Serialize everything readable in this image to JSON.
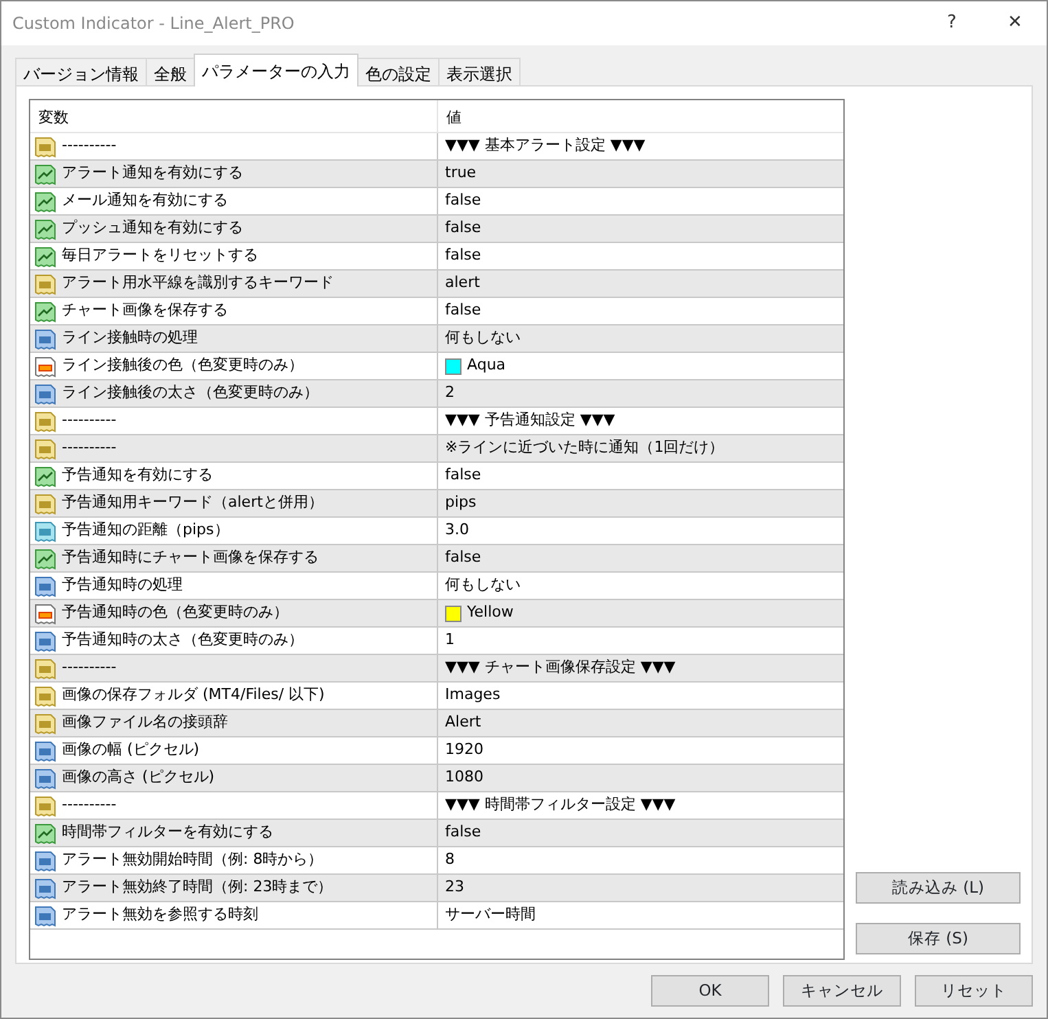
{
  "window": {
    "title": "Custom Indicator - Line_Alert_PRO",
    "help": "?",
    "close": "✕"
  },
  "tabs": [
    {
      "label": "バージョン情報",
      "selected": false
    },
    {
      "label": "全般",
      "selected": false
    },
    {
      "label": "パラメーターの入力",
      "selected": true
    },
    {
      "label": "色の設定",
      "selected": false
    },
    {
      "label": "表示選択",
      "selected": false
    }
  ],
  "table": {
    "columns": [
      "変数",
      "値"
    ],
    "rows": [
      {
        "kind": "string",
        "name": "----------",
        "value": "▼▼▼ 基本アラート設定 ▼▼▼"
      },
      {
        "kind": "bool",
        "name": "アラート通知を有効にする",
        "value": "true"
      },
      {
        "kind": "bool",
        "name": "メール通知を有効にする",
        "value": "false"
      },
      {
        "kind": "bool",
        "name": "プッシュ通知を有効にする",
        "value": "false"
      },
      {
        "kind": "bool",
        "name": "毎日アラートをリセットする",
        "value": "false"
      },
      {
        "kind": "string",
        "name": "アラート用水平線を識別するキーワード",
        "value": "alert"
      },
      {
        "kind": "bool",
        "name": "チャート画像を保存する",
        "value": "false"
      },
      {
        "kind": "int",
        "name": "ライン接触時の処理",
        "value": "何もしない"
      },
      {
        "kind": "color",
        "name": "ライン接触後の色（色変更時のみ）",
        "value": "Aqua",
        "color": "#00ffff"
      },
      {
        "kind": "int",
        "name": "ライン接触後の太さ（色変更時のみ）",
        "value": "2"
      },
      {
        "kind": "string",
        "name": "----------",
        "value": "▼▼▼ 予告通知設定 ▼▼▼"
      },
      {
        "kind": "string",
        "name": "----------",
        "value": "※ラインに近づいた時に通知（1回だけ）"
      },
      {
        "kind": "bool",
        "name": "予告通知を有効にする",
        "value": "false"
      },
      {
        "kind": "string",
        "name": "予告通知用キーワード（alertと併用）",
        "value": "pips"
      },
      {
        "kind": "double",
        "name": "予告通知の距離（pips）",
        "value": "3.0"
      },
      {
        "kind": "bool",
        "name": "予告通知時にチャート画像を保存する",
        "value": "false"
      },
      {
        "kind": "int",
        "name": "予告通知時の処理",
        "value": "何もしない"
      },
      {
        "kind": "color",
        "name": "予告通知時の色（色変更時のみ）",
        "value": "Yellow",
        "color": "#ffff00"
      },
      {
        "kind": "int",
        "name": "予告通知時の太さ（色変更時のみ）",
        "value": "1"
      },
      {
        "kind": "string",
        "name": "----------",
        "value": "▼▼▼ チャート画像保存設定 ▼▼▼"
      },
      {
        "kind": "string",
        "name": "画像の保存フォルダ (MT4/Files/ 以下)",
        "value": "Images"
      },
      {
        "kind": "string",
        "name": "画像ファイル名の接頭辞",
        "value": "Alert"
      },
      {
        "kind": "int",
        "name": "画像の幅 (ピクセル)",
        "value": "1920"
      },
      {
        "kind": "int",
        "name": "画像の高さ (ピクセル)",
        "value": "1080"
      },
      {
        "kind": "string",
        "name": "----------",
        "value": "▼▼▼ 時間帯フィルター設定 ▼▼▼"
      },
      {
        "kind": "bool",
        "name": "時間帯フィルターを有効にする",
        "value": "false"
      },
      {
        "kind": "int",
        "name": "アラート無効開始時間（例: 8時から）",
        "value": "8"
      },
      {
        "kind": "int",
        "name": "アラート無効終了時間（例: 23時まで）",
        "value": "23"
      },
      {
        "kind": "int",
        "name": "アラート無効を参照する時刻",
        "value": "サーバー時間"
      }
    ]
  },
  "side_buttons": [
    "読み込み (L)",
    "保存 (S)"
  ],
  "buttons": [
    "OK",
    "キャンセル",
    "リセット"
  ]
}
